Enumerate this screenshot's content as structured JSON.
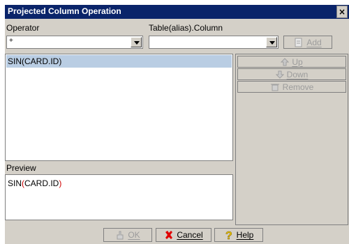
{
  "window": {
    "title": "Projected Column Operation",
    "close_glyph": "×"
  },
  "operator": {
    "label": "Operator",
    "value": "+"
  },
  "column": {
    "label": "Table(alias).Column",
    "value": ""
  },
  "buttons": {
    "add": "Add",
    "up": "Up",
    "down": "Down",
    "remove": "Remove",
    "ok": "OK",
    "cancel": "Cancel",
    "help": "Help"
  },
  "expression_list": {
    "items": [
      "SIN(CARD.ID)"
    ]
  },
  "preview": {
    "label": "Preview",
    "fn_name": "SIN",
    "open_paren": "(",
    "arg": "CARD.ID",
    "close_paren": ")"
  },
  "colors": {
    "titlebar": "#0a246a",
    "panel": "#d4d0c8",
    "selection": "#b9cde3",
    "paren": "#d00000"
  },
  "icons": [
    "close-icon",
    "dropdown-arrow-icon",
    "add-icon",
    "up-arrow-icon",
    "down-arrow-icon",
    "remove-icon",
    "ok-icon",
    "cancel-x-icon",
    "help-icon"
  ]
}
